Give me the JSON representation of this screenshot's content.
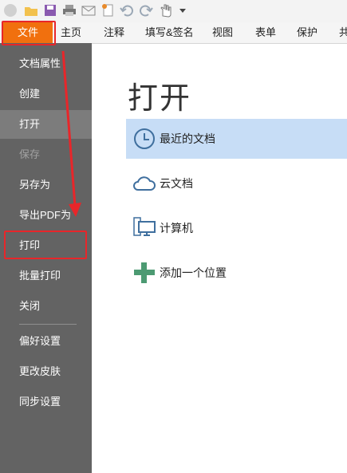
{
  "quick_access": {
    "icons": [
      "circle-icon",
      "open-folder-icon",
      "save-icon",
      "print-icon",
      "email-icon",
      "new-document-icon",
      "undo-icon",
      "redo-icon",
      "hand-tool-icon",
      "dropdown-arrow-icon"
    ]
  },
  "ribbon_tabs": [
    "文件",
    "主页",
    "注释",
    "填写&签名",
    "视图",
    "表单",
    "保护",
    "共"
  ],
  "nav": {
    "items": [
      "文档属性",
      "创建",
      "打开",
      "保存",
      "另存为",
      "导出PDF为",
      "打印",
      "批量打印",
      "关闭",
      "偏好设置",
      "更改皮肤",
      "同步设置"
    ],
    "active": "打开",
    "disabled": "保存"
  },
  "panel": {
    "title": "打开",
    "locations": [
      "最近的文档",
      "云文档",
      "计算机",
      "添加一个位置"
    ],
    "selected": "最近的文档"
  },
  "annotation_color": "#e8262a",
  "accent_color": "#f1700e"
}
